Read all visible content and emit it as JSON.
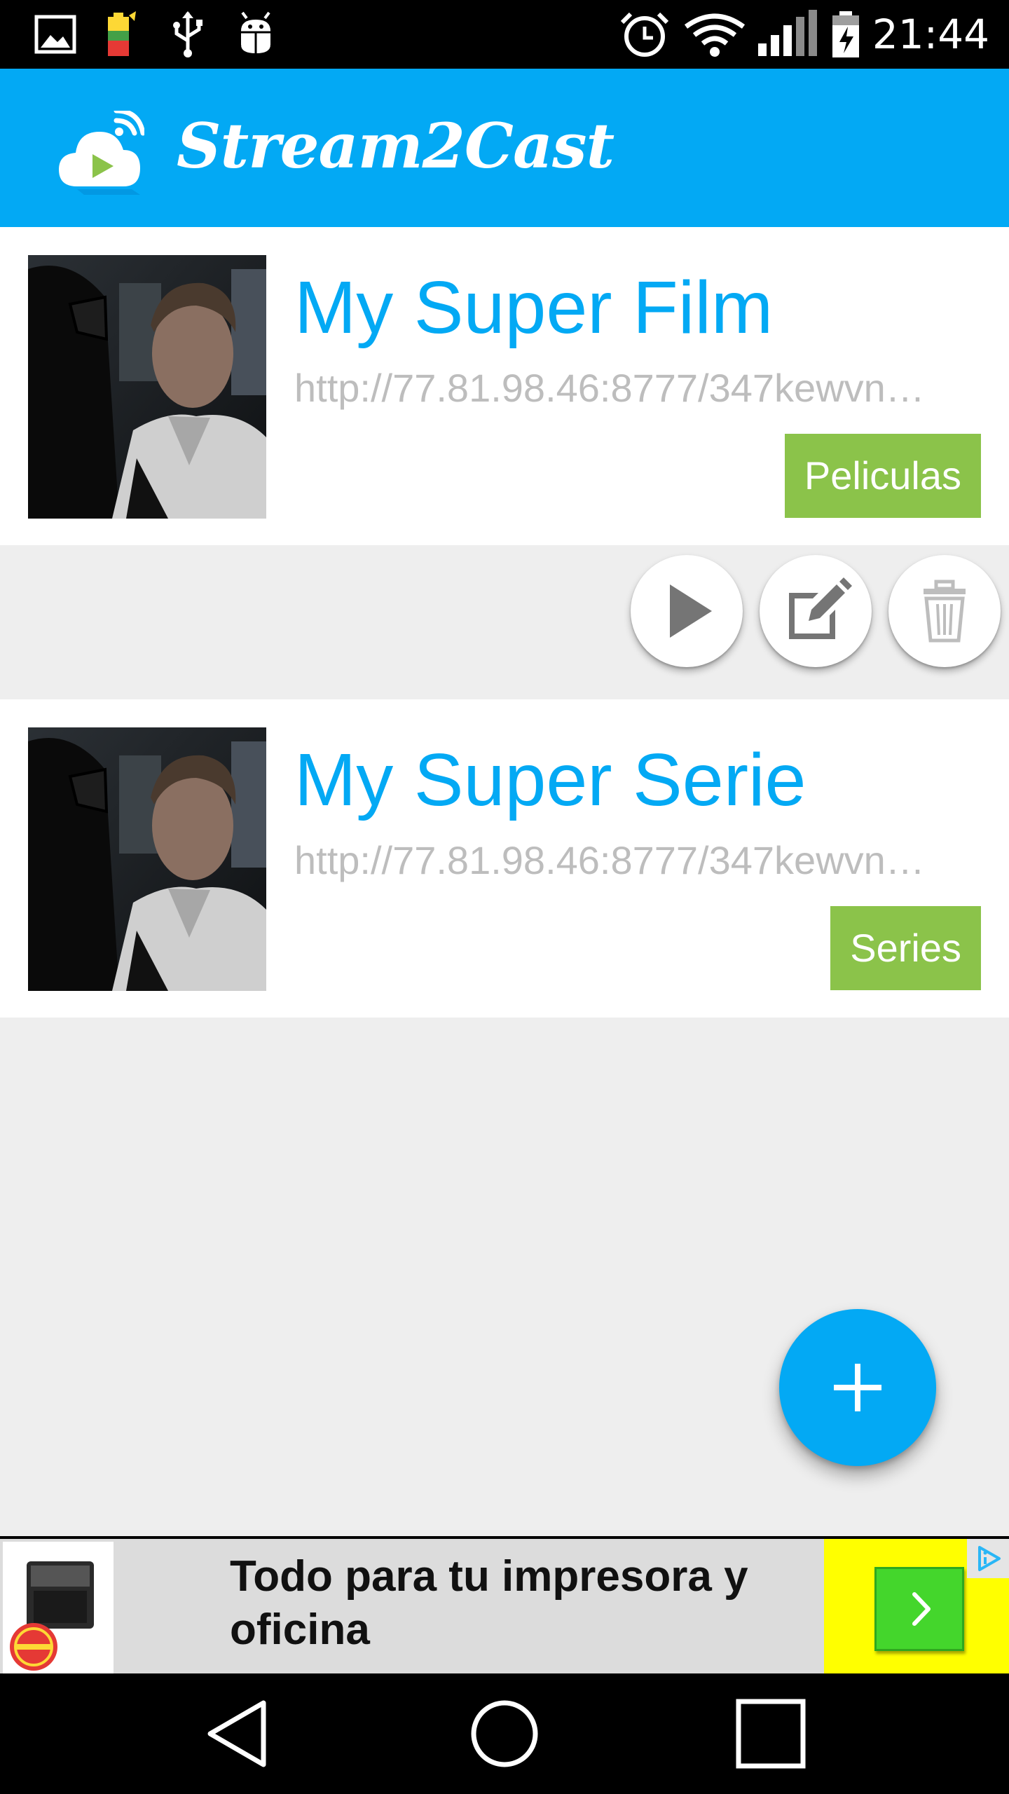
{
  "status_bar": {
    "time": "21:44",
    "icons": [
      "image-icon",
      "battery-saver-icon",
      "usb-icon",
      "android-debug-icon",
      "alarm-icon",
      "wifi-icon",
      "signal-icon",
      "battery-charging-icon"
    ]
  },
  "app_bar": {
    "title": "Stream2Cast",
    "logo_icon": "cloud-play-cast-icon",
    "color": "#03a9f4"
  },
  "items": [
    {
      "title": "My Super Film",
      "url": "http://77.81.98.46:8777/347kewvn…",
      "tag": "Peliculas"
    },
    {
      "title": "My Super Serie",
      "url": "http://77.81.98.46:8777/347kewvn…",
      "tag": "Series"
    }
  ],
  "actions": {
    "play_icon": "play-icon",
    "edit_icon": "edit-icon",
    "delete_icon": "trash-icon"
  },
  "fab": {
    "icon": "plus-icon",
    "color": "#03a9f4"
  },
  "ad": {
    "text": "Todo para tu impresora y oficina",
    "go_icon": "chevron-right-icon",
    "adchoices_icon": "adchoices-icon"
  },
  "nav_bar": {
    "icons": [
      "back-icon",
      "home-icon",
      "recents-icon"
    ]
  },
  "colors": {
    "accent": "#03a9f4",
    "tag": "#8bc34a",
    "url_text": "#bdbdbd",
    "background": "#eeeeee"
  }
}
